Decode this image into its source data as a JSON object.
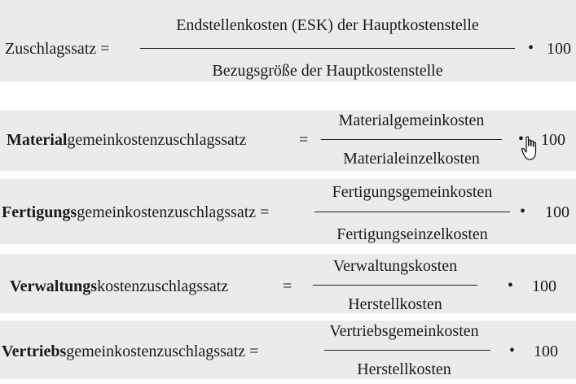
{
  "formulas": [
    {
      "label_bold": "",
      "label_rest": "Zuschlagssatz =",
      "numerator": "Endstellenkosten (ESK) der Hauptkostenstelle",
      "denominator": "Bezugsgröße der Hauptkostenstelle",
      "dot": "•",
      "factor": "100"
    },
    {
      "label_bold": "Material",
      "label_rest": "gemeinkostenzuschlagssatz",
      "equals": "=",
      "numerator": "Materialgemeinkosten",
      "denominator": "Materialeinzelkosten",
      "dot": "•",
      "factor": "100"
    },
    {
      "label_bold": "Fertigungs",
      "label_rest": "gemeinkostenzuschlagssatz =",
      "numerator": "Fertigungsgemeinkosten",
      "denominator": "Fertigungseinzelkosten",
      "dot": "•",
      "factor": "100"
    },
    {
      "label_bold": "Verwaltungs",
      "label_rest": "kostenzuschlagssatz",
      "equals": "=",
      "numerator": "Verwaltungskosten",
      "denominator": "Herstellkosten",
      "dot": "•",
      "factor": "100"
    },
    {
      "label_bold": "Vertriebs",
      "label_rest": "gemeinkostenzuschlagssatz =",
      "numerator": "Vertriebsgemeinkosten",
      "denominator": "Herstellkosten",
      "dot": "•",
      "factor": "100"
    }
  ],
  "cursor": {
    "icon": "hand-cursor-icon"
  },
  "colors": {
    "band": "#ebebeb",
    "text": "#1a1a1a"
  }
}
